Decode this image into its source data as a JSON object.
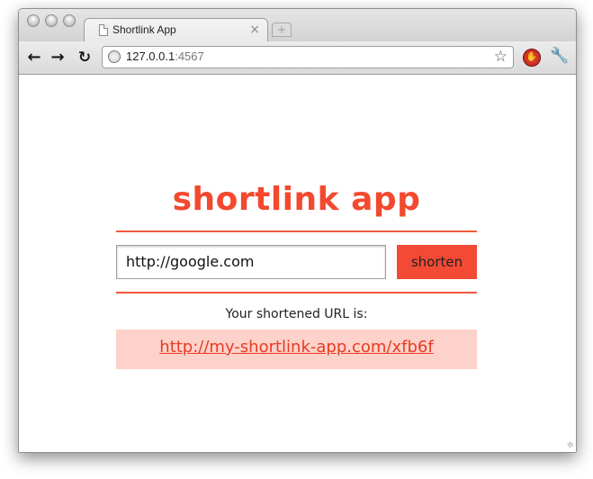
{
  "browser": {
    "tab_title": "Shortlink App",
    "tab_close": "×",
    "new_tab": "+",
    "url_host": "127.0.0.1",
    "url_port": ":4567",
    "icons": {
      "back": "arrow-left-icon",
      "forward": "arrow-right-icon",
      "reload": "reload-icon",
      "globe": "globe-icon",
      "star": "star-icon",
      "extension": "stop-extension-icon",
      "wrench": "wrench-icon"
    }
  },
  "page": {
    "title": "shortlink app",
    "input_value": "http://google.com",
    "button_label": "shorten",
    "result_label": "Your shortened URL is:",
    "result_url": "http://my-shortlink-app.com/xfb6f",
    "colors": {
      "accent": "#f34a35",
      "result_bg": "#fdd2cb"
    }
  }
}
